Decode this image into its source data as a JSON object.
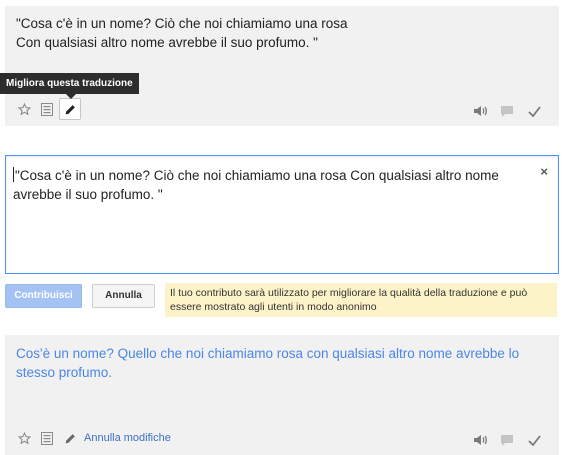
{
  "original_panel": {
    "text_line1": "\"Cosa c'è in un nome? Ciò che noi chiamiamo una rosa",
    "text_line2": "Con qualsiasi altro nome avrebbe il suo profumo. \"",
    "tooltip": "Migliora questa traduzione",
    "toolbar_left": [
      "star-icon",
      "list-icon",
      "pencil-icon"
    ],
    "toolbar_right": [
      "speaker-icon",
      "comment-icon",
      "checkmark-icon"
    ]
  },
  "edit_box": {
    "value": "\"Cosa c'è in un nome? Ciò che noi chiamiamo una rosa Con qualsiasi altro nome avrebbe il suo profumo. \"",
    "clear_icon": "×"
  },
  "actions": {
    "contribute_label": "Contribuisci",
    "cancel_label": "Annulla",
    "notice": "Il tuo contributo sarà utilizzato per migliorare la qualità della traduzione e può essere mostrato agli utenti in modo anonimo"
  },
  "result_panel": {
    "text": "Cos'è un nome? Quello che noi chiamiamo rosa con qualsiasi altro nome avrebbe lo stesso profumo.",
    "undo_label": "Annulla modifiche",
    "toolbar_left": [
      "star-icon",
      "list-icon",
      "pencil-icon"
    ],
    "toolbar_right": [
      "speaker-icon",
      "comment-icon",
      "checkmark-icon"
    ]
  },
  "colors": {
    "accent_blue": "#4d90fe",
    "result_text": "#4a86e8",
    "primary_button": "#a4c2f4",
    "notice_bg": "#fdf3c8",
    "panel_bg": "#f1f1f1"
  }
}
